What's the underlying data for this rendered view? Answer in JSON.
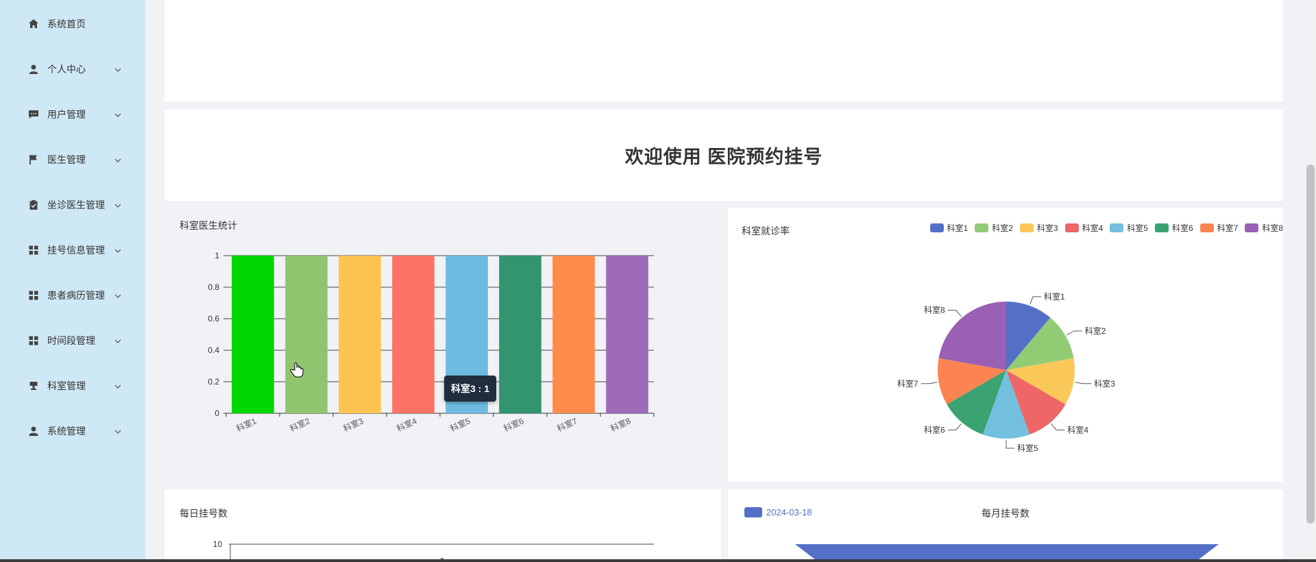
{
  "sidebar": {
    "items": [
      {
        "label": "系统首页",
        "icon": "home-icon",
        "has_children": false
      },
      {
        "label": "个人中心",
        "icon": "user-icon",
        "has_children": true
      },
      {
        "label": "用户管理",
        "icon": "chat-icon",
        "has_children": true
      },
      {
        "label": "医生管理",
        "icon": "flag-icon",
        "has_children": true
      },
      {
        "label": "坐诊医生管理",
        "icon": "clipboard-check-icon",
        "has_children": true
      },
      {
        "label": "挂号信息管理",
        "icon": "grid-icon",
        "has_children": true
      },
      {
        "label": "患者病历管理",
        "icon": "grid-icon",
        "has_children": true
      },
      {
        "label": "时间段管理",
        "icon": "grid-icon",
        "has_children": true
      },
      {
        "label": "科室管理",
        "icon": "stamp-icon",
        "has_children": true
      },
      {
        "label": "系统管理",
        "icon": "user-config-icon",
        "has_children": true
      }
    ]
  },
  "welcome": {
    "title": "欢迎使用 医院预约挂号"
  },
  "cards": {
    "bar_title": "科室医生统计",
    "pie_title": "科室就诊率",
    "daily_title": "每日挂号数",
    "monthly_title": "每月挂号数",
    "monthly_legend": "2024-03-18"
  },
  "tooltip": {
    "text": "科室3 : 1"
  },
  "colors": {
    "sidebar_bg": "#cfe8f5",
    "accent": "#5470c6"
  },
  "chart_data": [
    {
      "type": "bar",
      "title": "科室医生统计",
      "categories": [
        "科室1",
        "科室2",
        "科室3",
        "科室4",
        "科室5",
        "科室6",
        "科室7",
        "科室8"
      ],
      "values": [
        1,
        1,
        1,
        1,
        1,
        1,
        1,
        1
      ],
      "colors": [
        "#00d600",
        "#91c46f",
        "#fdc452",
        "#fb7364",
        "#6ebbe2",
        "#31956f",
        "#fe8b4a",
        "#9d6bba"
      ],
      "yticks": [
        "0",
        "0.2",
        "0.4",
        "0.6",
        "0.8",
        "1"
      ],
      "ylim": [
        0,
        1
      ],
      "grid": true
    },
    {
      "type": "pie",
      "title": "科室就诊率",
      "categories": [
        "科室1",
        "科室2",
        "科室3",
        "科室4",
        "科室5",
        "科室6",
        "科室7",
        "科室8"
      ],
      "values": [
        1,
        1,
        1,
        1,
        1,
        1,
        1,
        2
      ],
      "colors": [
        "#5470c6",
        "#91cc75",
        "#fac858",
        "#ee6666",
        "#73c0de",
        "#3ba272",
        "#fc8452",
        "#9a60b4"
      ],
      "legend": "top-right"
    },
    {
      "type": "line",
      "title": "每日挂号数",
      "yticks": [
        "10"
      ]
    },
    {
      "type": "bar",
      "title": "每月挂号数",
      "series": [
        {
          "name": "2024-03-18"
        }
      ],
      "legend": "top-left"
    }
  ]
}
